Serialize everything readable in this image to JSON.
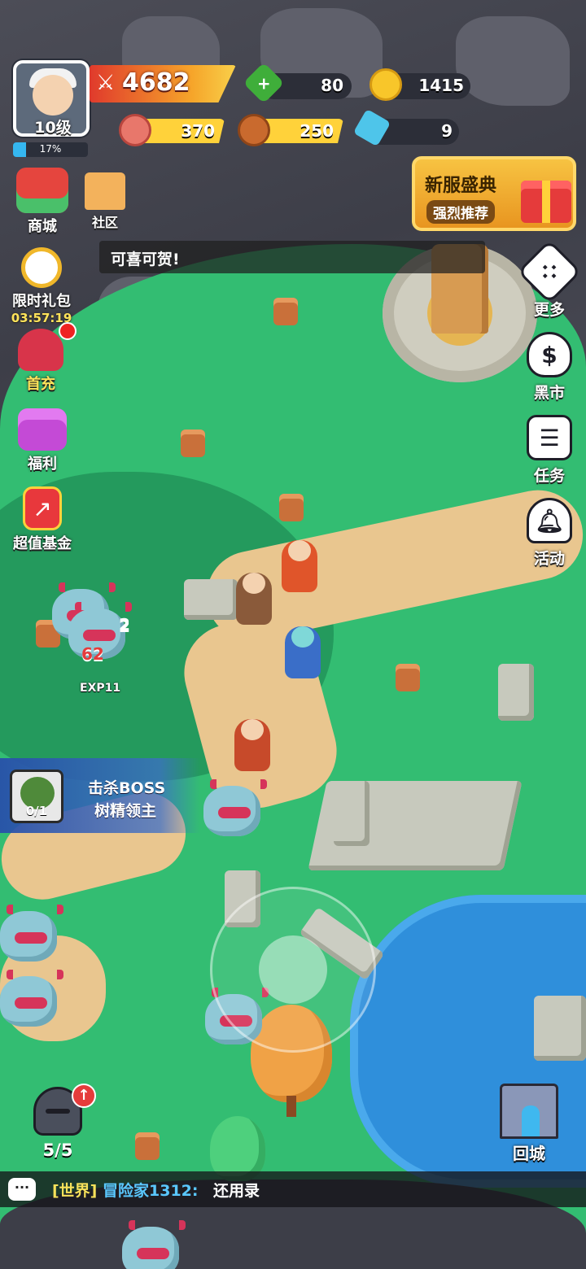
{
  "player": {
    "level": "10级",
    "xp_percent": "17%",
    "xp_fraction": 0.17,
    "power": "4682"
  },
  "resources": {
    "green_gems": "80",
    "gold": "1415",
    "meat": "370",
    "wood": "250",
    "crystal": "9"
  },
  "left_menu": {
    "shop": "商城",
    "community": "社区",
    "limited_pack": "限时礼包",
    "limited_timer": "03:57:19",
    "first_charge": "首充",
    "welfare": "福利",
    "fund": "超值基金"
  },
  "event_banner": {
    "title": "新服盛典",
    "subtitle": "强烈推荐"
  },
  "toast": "可喜可贺!",
  "right_menu": {
    "more": "更多",
    "black_market": "黑市",
    "tasks": "任务",
    "events": "活动"
  },
  "quest": {
    "line1": "击杀BOSS",
    "line2": "树精领主",
    "progress": "0/1"
  },
  "combat": {
    "damage_1": "2",
    "damage_2": "62",
    "exp": "EXP11"
  },
  "squad": {
    "count": "5/5"
  },
  "city": {
    "label": "回城"
  },
  "chat": {
    "channel": "[世界]",
    "sender": "冒险家1312:",
    "message": "还用录"
  },
  "colors": {
    "grass": "#33bd72",
    "path": "#e9c68f",
    "water": "#2f8fdb",
    "power_bar": "#e03a2c",
    "resource_bar": "#ffd23a"
  }
}
